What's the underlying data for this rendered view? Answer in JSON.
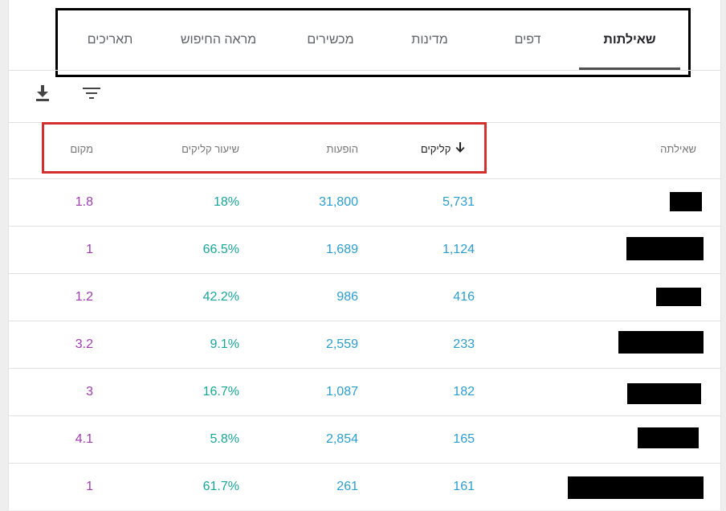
{
  "tabs": [
    {
      "label": "שאילתות",
      "active": true
    },
    {
      "label": "דפים",
      "active": false
    },
    {
      "label": "מדינות",
      "active": false
    },
    {
      "label": "מכשירים",
      "active": false
    },
    {
      "label": "מראה החיפוש",
      "active": false
    },
    {
      "label": "תאריכים",
      "active": false
    }
  ],
  "toolbar": {
    "download_icon": "download-icon",
    "filter_icon": "filter-icon"
  },
  "table": {
    "headers": {
      "query": "שאילתה",
      "clicks": "קליקים",
      "impressions": "הופעות",
      "ctr": "שיעור קליקים",
      "position": "מקום"
    },
    "sort_icon": "arrow-down-icon",
    "rows": [
      {
        "clicks": "5,731",
        "impressions": "31,800",
        "ctr": "18%",
        "position": "1.8"
      },
      {
        "clicks": "1,124",
        "impressions": "1,689",
        "ctr": "66.5%",
        "position": "1"
      },
      {
        "clicks": "416",
        "impressions": "986",
        "ctr": "42.2%",
        "position": "1.2"
      },
      {
        "clicks": "233",
        "impressions": "2,559",
        "ctr": "9.1%",
        "position": "3.2"
      },
      {
        "clicks": "182",
        "impressions": "1,087",
        "ctr": "16.7%",
        "position": "3"
      },
      {
        "clicks": "165",
        "impressions": "2,854",
        "ctr": "5.8%",
        "position": "4.1"
      },
      {
        "clicks": "161",
        "impressions": "261",
        "ctr": "61.7%",
        "position": "1"
      }
    ]
  },
  "colors": {
    "clicks": "#2a9ed1",
    "impressions": "#2a9ed1",
    "ctr": "#17a69a",
    "position": "#a23ab5",
    "highlight_red": "#d32f2f"
  }
}
